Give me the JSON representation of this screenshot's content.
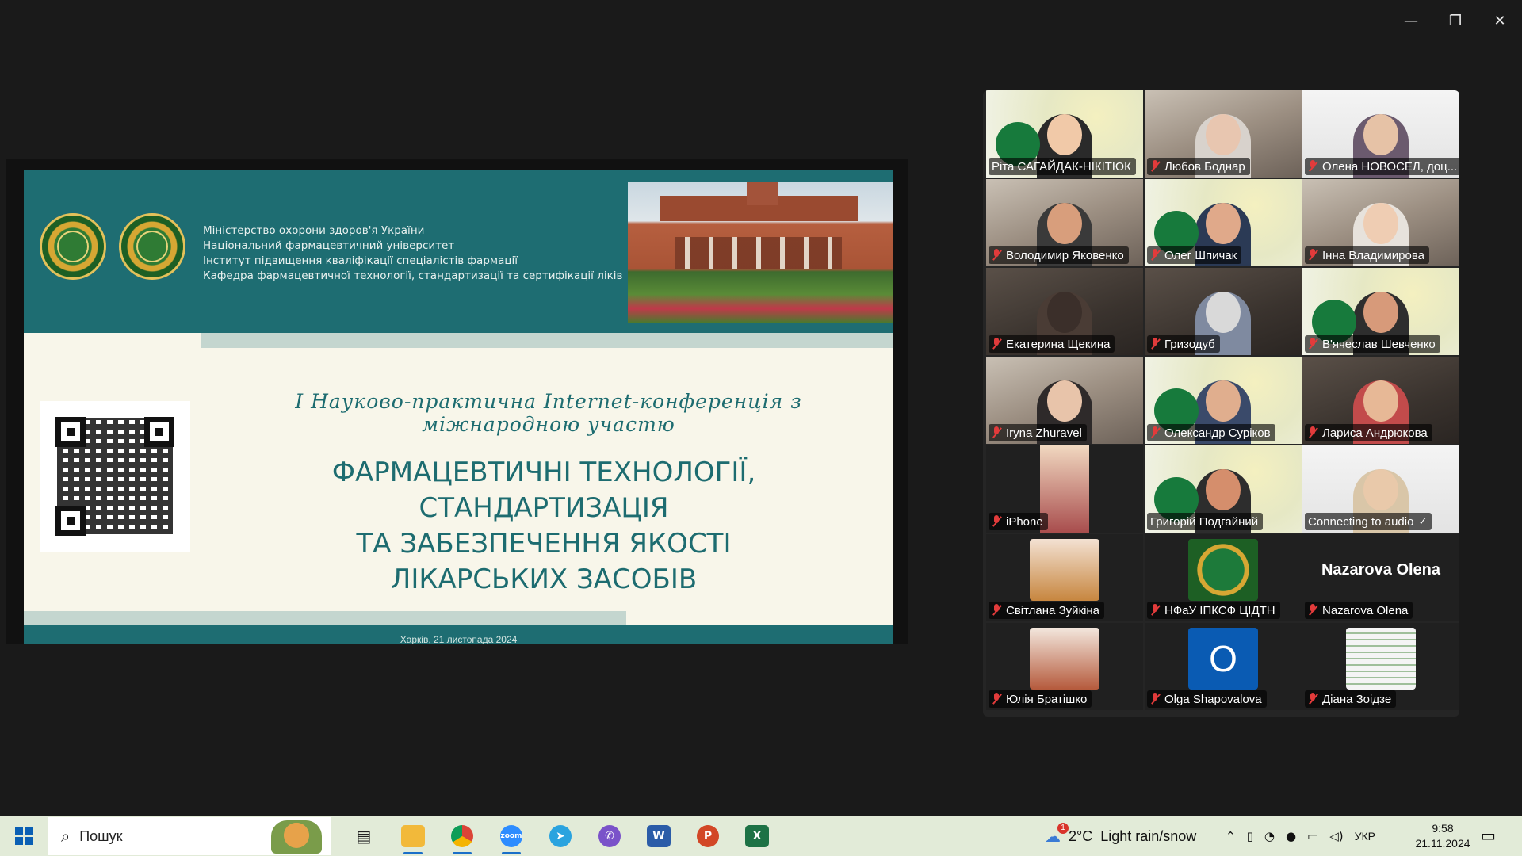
{
  "window": {
    "minimize": "—",
    "restore": "❐",
    "close": "✕"
  },
  "slide": {
    "org_lines": [
      "Міністерство охорони здоров'я України",
      "Національний фармацевтичний університет",
      "Інститут підвищення кваліфікації спеціалістів фармації",
      "Кафедра фармацевтичної технології, стандартизації та сертифікації ліків"
    ],
    "conference": "I Науково-практична Internet-конференція з міжнародною участю",
    "title_lines": [
      "ФАРМАЦЕВТИЧНІ ТЕХНОЛОГІЇ, СТАНДАРТИЗАЦІЯ",
      "ТА ЗАБЕЗПЕЧЕННЯ ЯКОСТІ",
      "ЛІКАРСЬКИХ ЗАСОБІВ"
    ],
    "footer": "Харків, 21 листопада 2024"
  },
  "participants": [
    {
      "name": "Ріта САГАЙДАК-НІКІТЮК",
      "muted": false
    },
    {
      "name": "Любов Боднар",
      "muted": true
    },
    {
      "name": "Олена НОВОСЕЛ, доц...",
      "muted": true
    },
    {
      "name": "Володимир Яковенко",
      "muted": true
    },
    {
      "name": "Олег Шпичак",
      "muted": true
    },
    {
      "name": "Інна Владимирова",
      "muted": true
    },
    {
      "name": "Екатерина Щекина",
      "muted": true
    },
    {
      "name": "Гризодуб",
      "muted": true
    },
    {
      "name": "В'ячеслав Шевченко",
      "muted": true
    },
    {
      "name": "Iryna Zhuravel",
      "muted": true
    },
    {
      "name": "Олександр Суріков",
      "muted": true
    },
    {
      "name": "Лариса Андрюкова",
      "muted": true
    },
    {
      "name": "iPhone",
      "muted": true
    },
    {
      "name": "Григорій Подгайний",
      "muted": false
    },
    {
      "name": "Connecting to audio",
      "muted": false
    },
    {
      "name": "Світлана Зуйкіна",
      "muted": true
    },
    {
      "name": "НФаУ ІПКСФ ЦІДТН",
      "muted": true
    },
    {
      "name": "Nazarova Olena",
      "muted": true
    },
    {
      "name": "Юлія Братішко",
      "muted": true
    },
    {
      "name": "Olga Shapovalova",
      "muted": true
    },
    {
      "name": "Діана Зоідзе",
      "muted": true
    }
  ],
  "big_name": "Nazarova Olena",
  "avatar_letter": "O",
  "taskbar": {
    "search_placeholder": "Пошук",
    "weather": "2°C  Light rain/snow",
    "weather_badge": "1",
    "lang": "УКР",
    "time": "9:58",
    "date": "21.11.2024"
  },
  "colors": {
    "teal": "#1e6d72",
    "taskbar": "#e2ebd8",
    "muted": "#e23b3b"
  }
}
